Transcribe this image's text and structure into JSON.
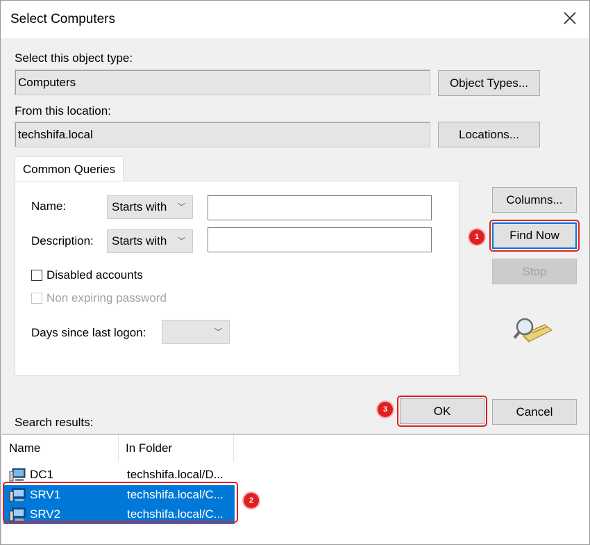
{
  "dialog": {
    "title": "Select Computers",
    "object_type_label": "Select this object type:",
    "object_type_value": "Computers",
    "object_types_button": "Object Types...",
    "location_label": "From this location:",
    "location_value": "techshifa.local",
    "locations_button": "Locations..."
  },
  "queries": {
    "tab_label": "Common Queries",
    "name_label": "Name:",
    "name_mode": "Starts with",
    "description_label": "Description:",
    "description_mode": "Starts with",
    "disabled_accounts_label": "Disabled accounts",
    "non_expiring_label": "Non expiring password",
    "days_label": "Days since last logon:"
  },
  "buttons": {
    "columns": "Columns...",
    "find_now": "Find Now",
    "stop": "Stop",
    "ok": "OK",
    "cancel": "Cancel"
  },
  "results": {
    "label": "Search results:",
    "columns": [
      "Name",
      "In Folder"
    ],
    "rows": [
      {
        "name": "DC1",
        "folder": "techshifa.local/D...",
        "selected": false
      },
      {
        "name": "SRV1",
        "folder": "techshifa.local/C...",
        "selected": true
      },
      {
        "name": "SRV2",
        "folder": "techshifa.local/C...",
        "selected": true
      }
    ]
  },
  "annotations": [
    "1",
    "2",
    "3"
  ],
  "colors": {
    "annotation_red": "#e02020",
    "selection_blue": "#0078d7",
    "dialog_bg": "#f0f0f0"
  }
}
